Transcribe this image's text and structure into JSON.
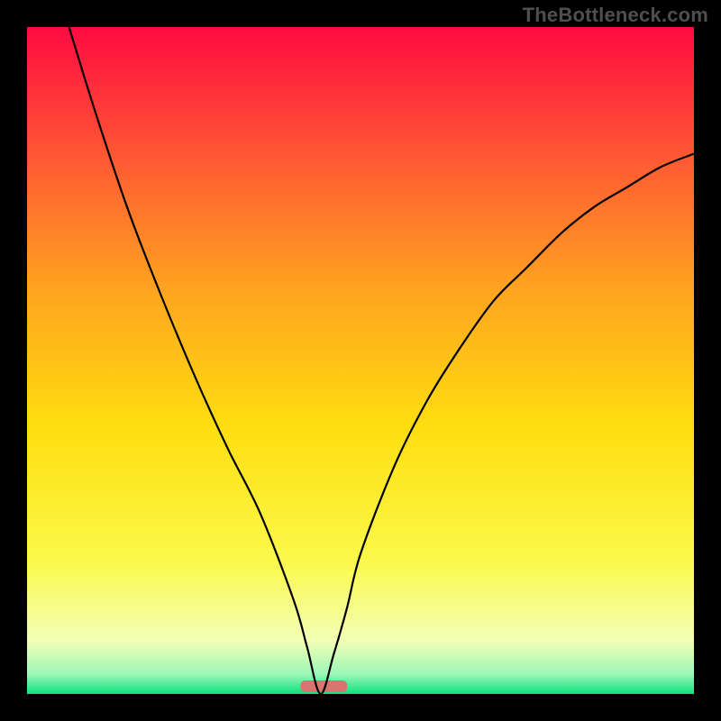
{
  "watermark": "TheBottleneck.com",
  "chart_data": {
    "type": "line",
    "title": "",
    "xlabel": "",
    "ylabel": "",
    "x_range": [
      0,
      100
    ],
    "y_range": [
      0,
      100
    ],
    "optimal_x": 44,
    "optimal_band": {
      "x_start": 41,
      "x_end": 48,
      "color": "#d9746e"
    },
    "background_gradient": [
      {
        "y": 100,
        "color": "#ff0b42"
      },
      {
        "y": 80,
        "color": "#ff5a33"
      },
      {
        "y": 60,
        "color": "#ffa61f"
      },
      {
        "y": 40,
        "color": "#ffde10"
      },
      {
        "y": 20,
        "color": "#fbf94a"
      },
      {
        "y": 8,
        "color": "#f4ffb6"
      },
      {
        "y": 3,
        "color": "#9cf8b8"
      },
      {
        "y": 0,
        "color": "#0de080"
      }
    ],
    "series": [
      {
        "name": "bottleneck-curve",
        "color": "#000000",
        "x": [
          6.3,
          10,
          15,
          20,
          25,
          30,
          35,
          40,
          42,
          44,
          46,
          48,
          50,
          55,
          60,
          65,
          70,
          75,
          80,
          85,
          90,
          95,
          100
        ],
        "values": [
          100,
          88,
          73,
          60,
          48,
          37,
          27,
          14,
          7,
          0,
          6,
          13,
          21,
          34,
          44,
          52,
          59,
          64,
          69,
          73,
          76,
          79,
          81
        ]
      }
    ]
  }
}
